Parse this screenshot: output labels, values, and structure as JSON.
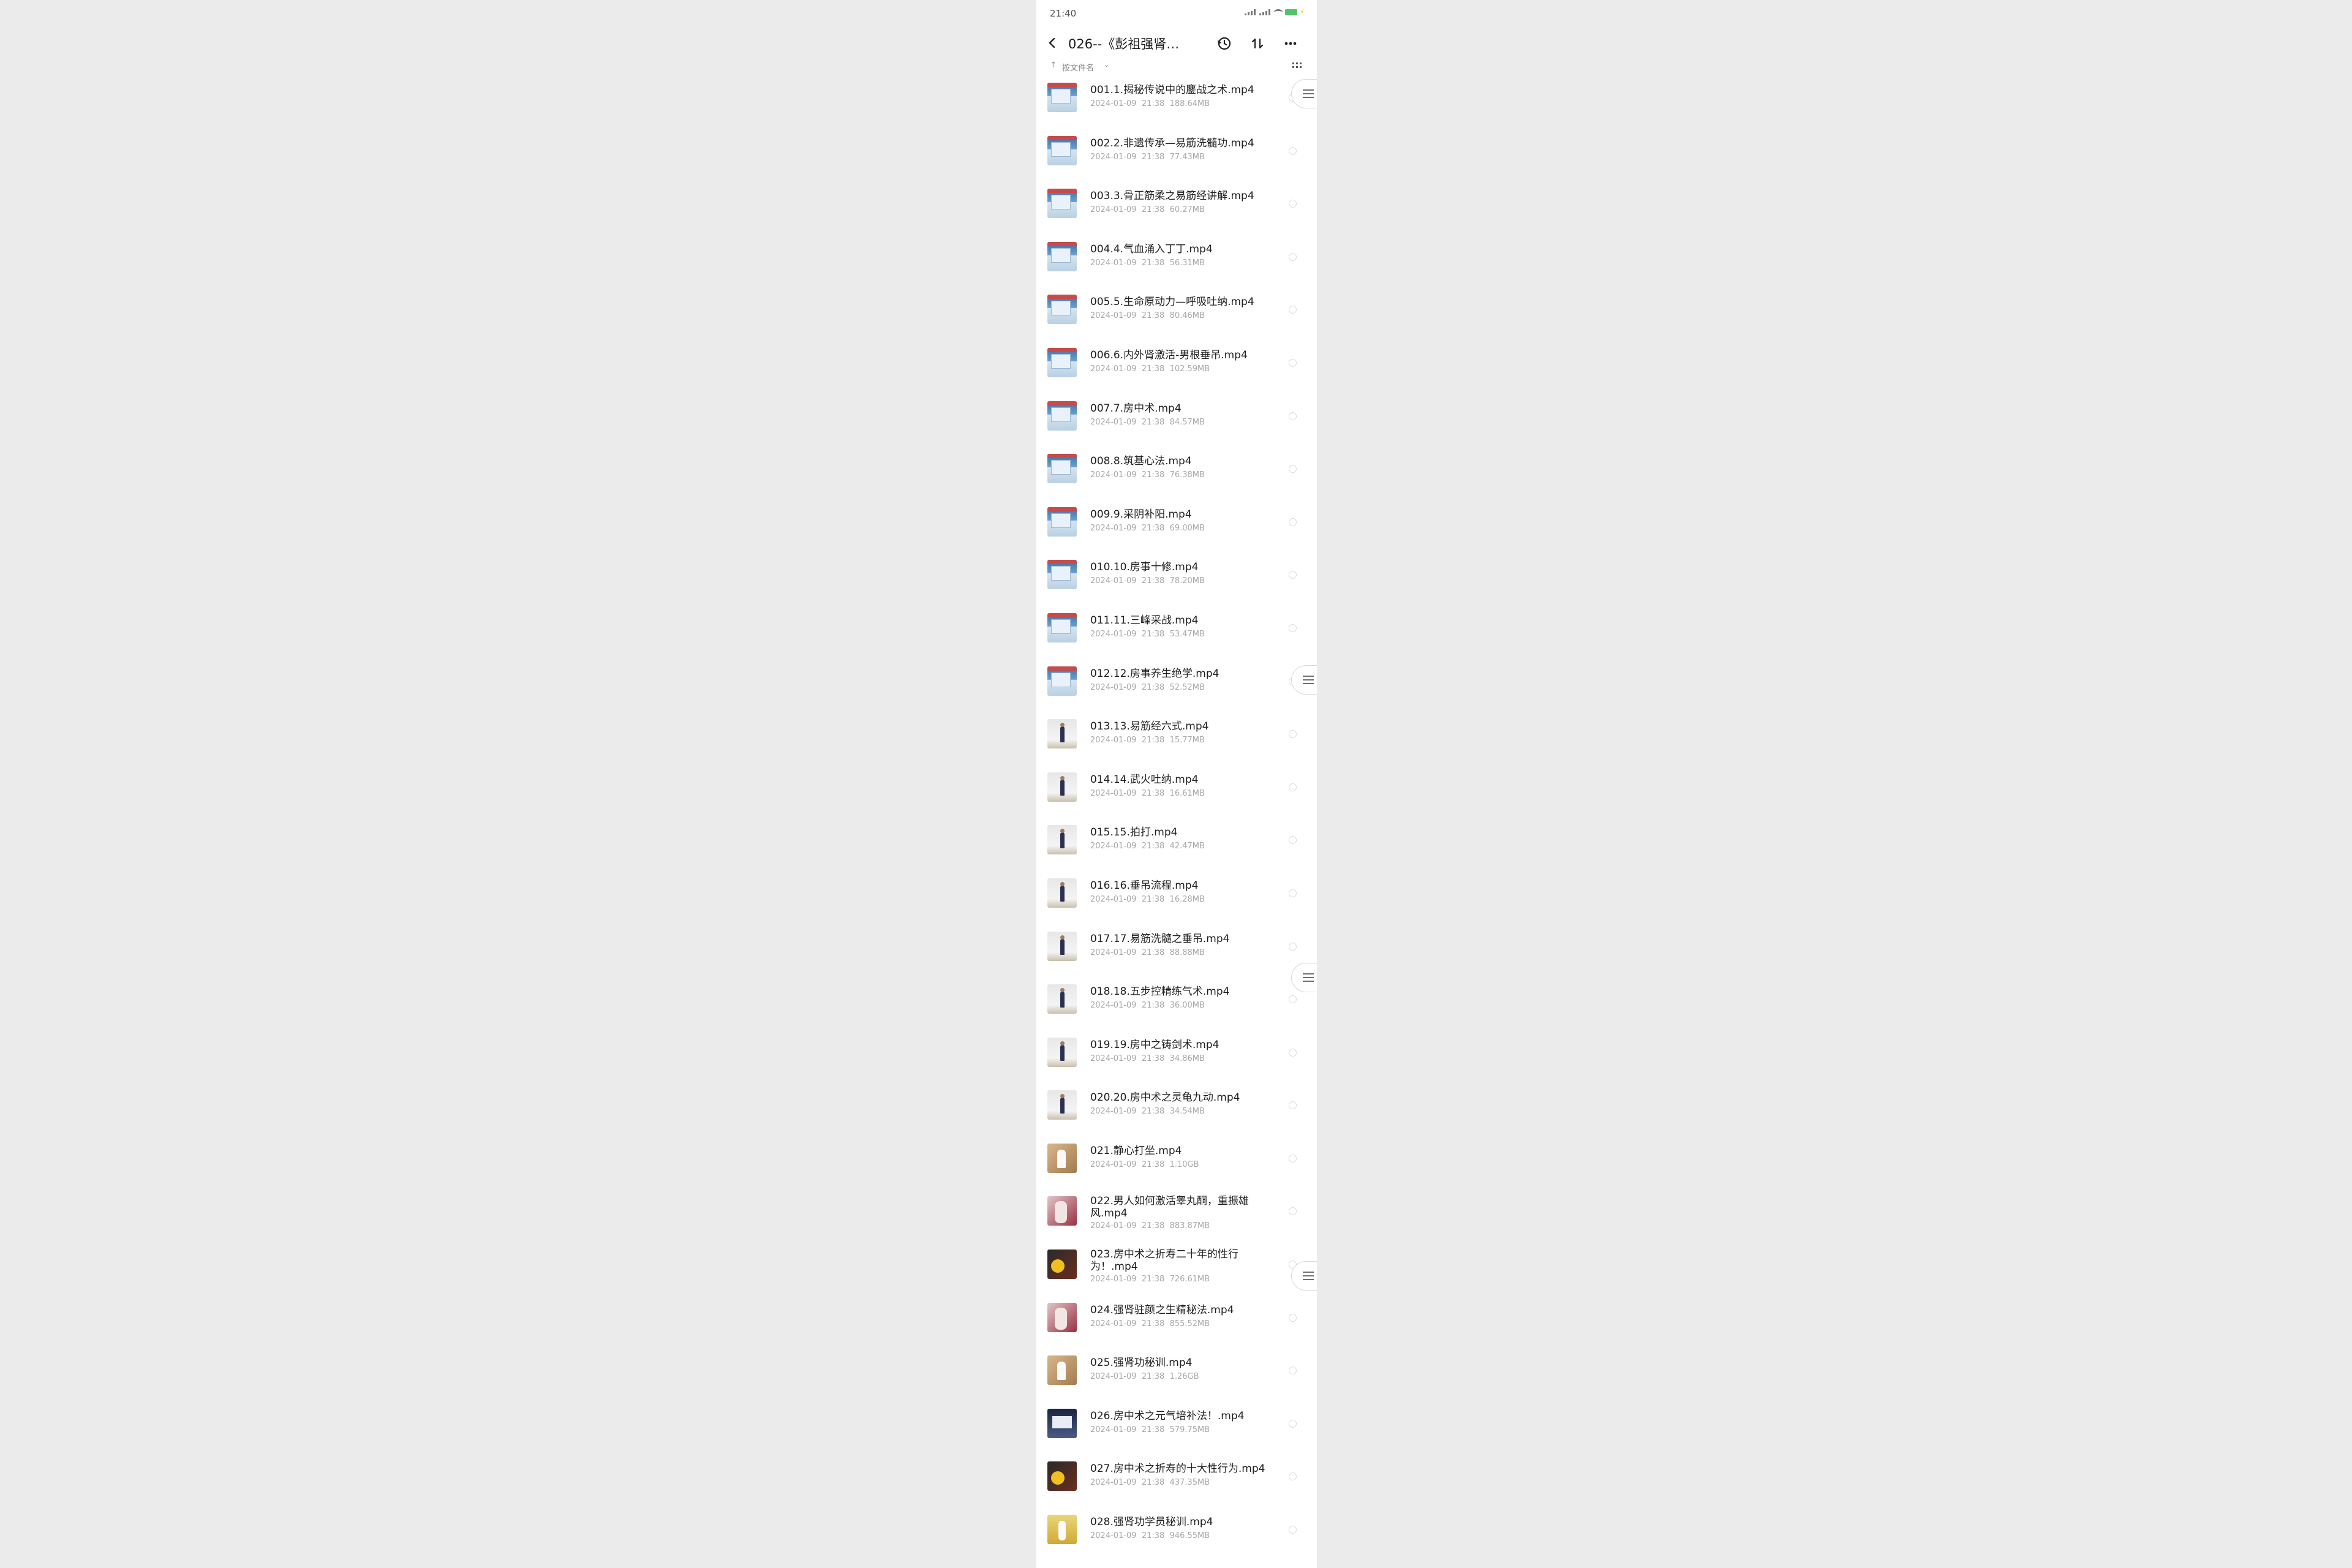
{
  "status": {
    "time": "21:40"
  },
  "header": {
    "title": "026--《彭祖强肾…"
  },
  "sort": {
    "label": "按文件名"
  },
  "files": [
    {
      "name": "001.1.揭秘传说中的鏖战之术.mp4",
      "date": "2024-01-09",
      "time": "21:38",
      "size": "188.64MB",
      "thumb": "classroom"
    },
    {
      "name": "002.2.非遗传承—易筋洗髓功.mp4",
      "date": "2024-01-09",
      "time": "21:38",
      "size": "77.43MB",
      "thumb": "classroom"
    },
    {
      "name": "003.3.骨正筋柔之易筋经讲解.mp4",
      "date": "2024-01-09",
      "time": "21:38",
      "size": "60.27MB",
      "thumb": "classroom"
    },
    {
      "name": "004.4.气血涌入丁丁.mp4",
      "date": "2024-01-09",
      "time": "21:38",
      "size": "56.31MB",
      "thumb": "classroom"
    },
    {
      "name": "005.5.生命原动力—呼吸吐纳.mp4",
      "date": "2024-01-09",
      "time": "21:38",
      "size": "80.46MB",
      "thumb": "classroom"
    },
    {
      "name": "006.6.内外肾激活-男根垂吊.mp4",
      "date": "2024-01-09",
      "time": "21:38",
      "size": "102.59MB",
      "thumb": "classroom"
    },
    {
      "name": "007.7.房中术.mp4",
      "date": "2024-01-09",
      "time": "21:38",
      "size": "84.57MB",
      "thumb": "classroom"
    },
    {
      "name": "008.8.筑基心法.mp4",
      "date": "2024-01-09",
      "time": "21:38",
      "size": "76.38MB",
      "thumb": "classroom"
    },
    {
      "name": "009.9.采阴补阳.mp4",
      "date": "2024-01-09",
      "time": "21:38",
      "size": "69.00MB",
      "thumb": "classroom"
    },
    {
      "name": "010.10.房事十修.mp4",
      "date": "2024-01-09",
      "time": "21:38",
      "size": "78.20MB",
      "thumb": "classroom"
    },
    {
      "name": "011.11.三峰采战.mp4",
      "date": "2024-01-09",
      "time": "21:38",
      "size": "53.47MB",
      "thumb": "classroom"
    },
    {
      "name": "012.12.房事养生绝学.mp4",
      "date": "2024-01-09",
      "time": "21:38",
      "size": "52.52MB",
      "thumb": "classroom"
    },
    {
      "name": "013.13.易筋经六式.mp4",
      "date": "2024-01-09",
      "time": "21:38",
      "size": "15.77MB",
      "thumb": "studio"
    },
    {
      "name": "014.14.武火吐纳.mp4",
      "date": "2024-01-09",
      "time": "21:38",
      "size": "16.61MB",
      "thumb": "studio"
    },
    {
      "name": "015.15.拍打.mp4",
      "date": "2024-01-09",
      "time": "21:38",
      "size": "42.47MB",
      "thumb": "studio"
    },
    {
      "name": "016.16.垂吊流程.mp4",
      "date": "2024-01-09",
      "time": "21:38",
      "size": "16.28MB",
      "thumb": "studio"
    },
    {
      "name": "017.17.易筋洗髓之垂吊.mp4",
      "date": "2024-01-09",
      "time": "21:38",
      "size": "88.88MB",
      "thumb": "studio"
    },
    {
      "name": "018.18.五步控精练气术.mp4",
      "date": "2024-01-09",
      "time": "21:38",
      "size": "36.00MB",
      "thumb": "studio"
    },
    {
      "name": "019.19.房中之铸剑术.mp4",
      "date": "2024-01-09",
      "time": "21:38",
      "size": "34.86MB",
      "thumb": "studio"
    },
    {
      "name": "020.20.房中术之灵龟九动.mp4",
      "date": "2024-01-09",
      "time": "21:38",
      "size": "34.54MB",
      "thumb": "studio"
    },
    {
      "name": "021.静心打坐.mp4",
      "date": "2024-01-09",
      "time": "21:38",
      "size": "1.10GB",
      "thumb": "tan"
    },
    {
      "name": "022.男人如何激活睾丸酮，重振雄风.mp4",
      "date": "2024-01-09",
      "time": "21:38",
      "size": "883.87MB",
      "thumb": "pink"
    },
    {
      "name": "023.房中术之折寿二十年的性行为！.mp4",
      "date": "2024-01-09",
      "time": "21:38",
      "size": "726.61MB",
      "thumb": "dark"
    },
    {
      "name": "024.强肾驻颜之生精秘法.mp4",
      "date": "2024-01-09",
      "time": "21:38",
      "size": "855.52MB",
      "thumb": "pink"
    },
    {
      "name": "025.强肾功秘训.mp4",
      "date": "2024-01-09",
      "time": "21:38",
      "size": "1.26GB",
      "thumb": "tan"
    },
    {
      "name": "026.房中术之元气培补法！.mp4",
      "date": "2024-01-09",
      "time": "21:38",
      "size": "579.75MB",
      "thumb": "navy"
    },
    {
      "name": "027.房中术之折寿的十大性行为.mp4",
      "date": "2024-01-09",
      "time": "21:38",
      "size": "437.35MB",
      "thumb": "dark"
    },
    {
      "name": "028.强肾功学员秘训.mp4",
      "date": "2024-01-09",
      "time": "21:38",
      "size": "946.55MB",
      "thumb": "yellow"
    }
  ]
}
